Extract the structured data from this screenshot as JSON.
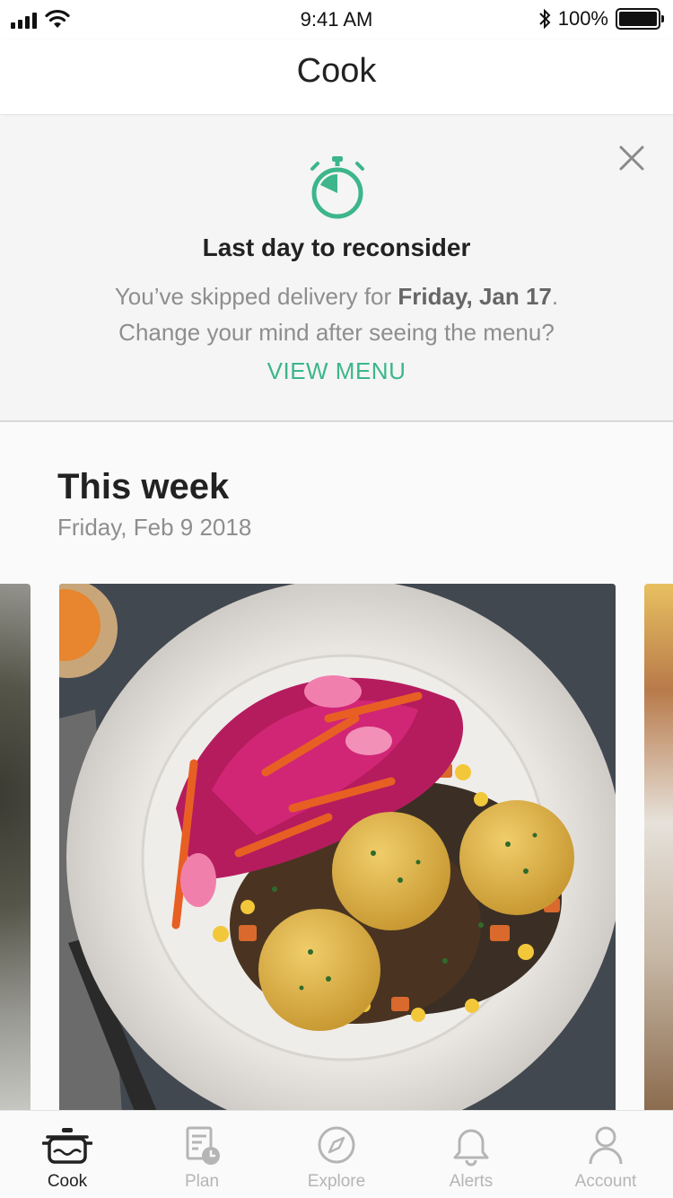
{
  "status_bar": {
    "time": "9:41 AM",
    "battery": "100%",
    "battery_level": 1.0,
    "icons": [
      "signal-icon",
      "wifi-icon",
      "bluetooth-icon",
      "battery-icon"
    ]
  },
  "nav": {
    "title": "Cook"
  },
  "banner": {
    "title": "Last day to reconsider",
    "line1_prefix": "You’ve skipped delivery for ",
    "line1_bold": "Friday, Jan 17",
    "line1_suffix": ".",
    "line2": "Change your mind after seeing the menu?",
    "cta": "VIEW MENU",
    "icons": [
      "stopwatch-icon",
      "close-icon"
    ]
  },
  "this_week": {
    "title": "This week",
    "date": "Friday, Feb 9 2018"
  },
  "tabs": [
    {
      "label": "Cook",
      "icon": "cooking-pot-icon",
      "active": true
    },
    {
      "label": "Plan",
      "icon": "calendar-clock-icon",
      "active": false
    },
    {
      "label": "Explore",
      "icon": "compass-icon",
      "active": false
    },
    {
      "label": "Alerts",
      "icon": "bell-icon",
      "active": false
    },
    {
      "label": "Account",
      "icon": "person-icon",
      "active": false
    }
  ],
  "colors": {
    "accent": "#3cb68a",
    "text_primary": "#222222",
    "text_secondary": "#8e8e8e",
    "tab_inactive": "#b5b5b5",
    "banner_bg": "#f5f5f5"
  }
}
